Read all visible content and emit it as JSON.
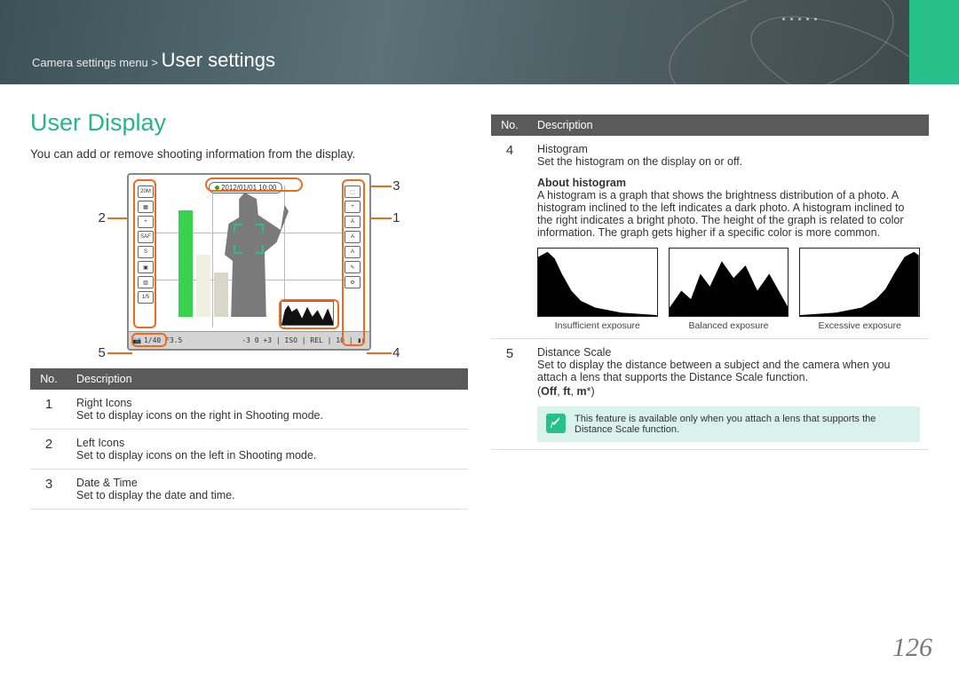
{
  "header": {
    "breadcrumb_prefix": "Camera settings menu > ",
    "breadcrumb_title": "User settings"
  },
  "title": "User Display",
  "intro": "You can add or remove shooting information from the display.",
  "display": {
    "date": "2012/01/01  10:00",
    "bottom": "1/40  F3.5",
    "markers": {
      "n1": "1",
      "n2": "2",
      "n3": "3",
      "n4": "4",
      "n5": "5"
    }
  },
  "table_left": {
    "head_no": "No.",
    "head_desc": "Description",
    "rows": [
      {
        "n": "1",
        "t": "Right Icons",
        "d": "Set to display icons on the right in Shooting mode."
      },
      {
        "n": "2",
        "t": "Left Icons",
        "d": "Set to display icons on the left in Shooting mode."
      },
      {
        "n": "3",
        "t": "Date & Time",
        "d": "Set to display the date and time."
      }
    ]
  },
  "table_right": {
    "head_no": "No.",
    "head_desc": "Description",
    "row4": {
      "n": "4",
      "t": "Histogram",
      "d1": "Set the histogram on the display on or off.",
      "sub_t": "About histogram",
      "sub_d": "A histogram is a graph that shows the brightness distribution of a photo. A histogram inclined to the left indicates a dark photo. A histogram inclined to the right indicates a bright photo. The height of the graph is related to color information. The graph gets higher if a specific color is more common.",
      "h1": "Insufficient exposure",
      "h2": "Balanced exposure",
      "h3": "Excessive exposure"
    },
    "row5": {
      "n": "5",
      "t": "Distance Scale",
      "d": "Set to display the distance between a subject and the camera when you attach a lens that supports the Distance Scale function.",
      "opts": "(Off, ft, m*)",
      "note": "This feature is available only when you attach a lens that supports the Distance Scale function."
    }
  },
  "page_number": "126"
}
